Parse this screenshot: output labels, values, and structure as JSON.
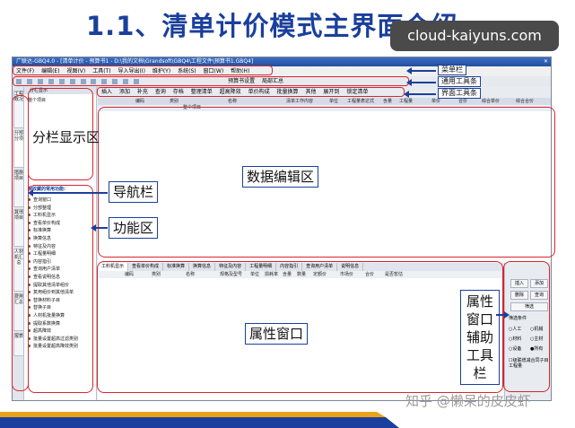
{
  "slide": {
    "title": "1.1、清单计价模式主界面介绍",
    "watermark_top": "cloud-kaiyuns.com",
    "watermark_bottom": "知乎 @懒呆的皮皮虾"
  },
  "app": {
    "title_bar": "广联达-GBQ4.0 - [清单计价 - 预算书1 - D:\\我的文档\\Grandsoft\\GBQ4\\工程文件\\预算书1.GBQ4]",
    "menu": [
      "文件(F)",
      "编辑(E)",
      "视图(V)",
      "工具(T)",
      "导入导出(I)",
      "维护(Y)",
      "系统(S)",
      "窗口(W)",
      "帮助(H)"
    ],
    "toolbar1_items": [
      "预算书设置",
      "局部汇总"
    ],
    "toolbar2_items": [
      "插入",
      "添加",
      "补充",
      "查询",
      "存档",
      "整理清单",
      "超高降效",
      "单价构成",
      "批量换算",
      "其他",
      "展开到",
      "锁定清单"
    ],
    "left_tabs": [
      "工程概况",
      "分部分项",
      "措施项目",
      "其他项目",
      "人材机汇总",
      "费用汇总",
      "报表"
    ],
    "nav": {
      "split_header": "分栏显示",
      "split_item": "整个项目",
      "func_header": "我收藏的常用功能:",
      "func_items": [
        "查询窗口",
        "分部整理",
        "工料机显示",
        "查看单价构成",
        "标准换算",
        "换算信息",
        "特征及内容",
        "工程量明细",
        "内容指引",
        "查询用户清单",
        "查看说明信息",
        "提取其他清单组价",
        "复用组价到其他清单",
        "替换材料子目",
        "替换子目",
        "人材机批量换算",
        "提取系数换算",
        "超高降效",
        "批量设置超高过滤类别",
        "批量设置超高降效类别"
      ]
    },
    "grid": {
      "columns": [
        "编码",
        "类别",
        "名称",
        "清单工作内容",
        "单位",
        "工程量表达式",
        "含量",
        "工程量",
        "单价",
        "合价",
        "综合单价",
        "综合合价"
      ],
      "first_row": "整个项目"
    },
    "prop": {
      "tabs": [
        "工料机显示",
        "查看单价构成",
        "标准换算",
        "换算信息",
        "特征及内容",
        "工程量明细",
        "内容指引",
        "查询用户清单",
        "说明信息"
      ],
      "columns": [
        "编码",
        "类别",
        "名称",
        "规格及型号",
        "单位",
        "损耗率",
        "含量",
        "数量",
        "定额价",
        "市场价",
        "合价",
        "是否暂估"
      ]
    },
    "aux": {
      "buttons": [
        "插入",
        "添加",
        "删除",
        "查询",
        "筛选"
      ],
      "filter_label": "筛选条件",
      "options": [
        "人工",
        "机械",
        "材料",
        "主材",
        "设备",
        "所有"
      ],
      "checkbox_label": "级联增减合同子目工程量"
    }
  },
  "annotations": {
    "menu_bar": "菜单栏",
    "common_toolbar": "通用工具条",
    "interface_toolbar": "界面工具条",
    "split_area": "分栏显示区",
    "navigation": "导航栏",
    "function_area": "功能区",
    "data_edit_area": "数据编辑区",
    "property_window": "属性窗口",
    "aux_toolbar": "属性窗口辅助工具栏"
  },
  "colors": {
    "annotation_red": "#d9242f",
    "callout_blue": "#1a3f9c",
    "title_blue": "#1a3f9c"
  }
}
